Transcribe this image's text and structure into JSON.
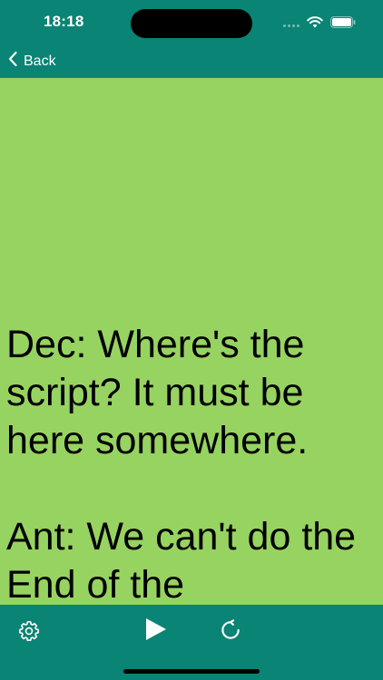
{
  "status_bar": {
    "time": "18:18"
  },
  "nav": {
    "back_label": "Back"
  },
  "script": {
    "text": "Dec: Where's the script? It must be here somewhere.\n\nAnt: We can't do the End of the"
  },
  "toolbar": {
    "settings_icon": "gear-icon",
    "play_icon": "play-icon",
    "refresh_icon": "refresh-icon"
  },
  "colors": {
    "bar_background": "#0a8474",
    "content_background": "#97d360",
    "text": "#000000"
  }
}
